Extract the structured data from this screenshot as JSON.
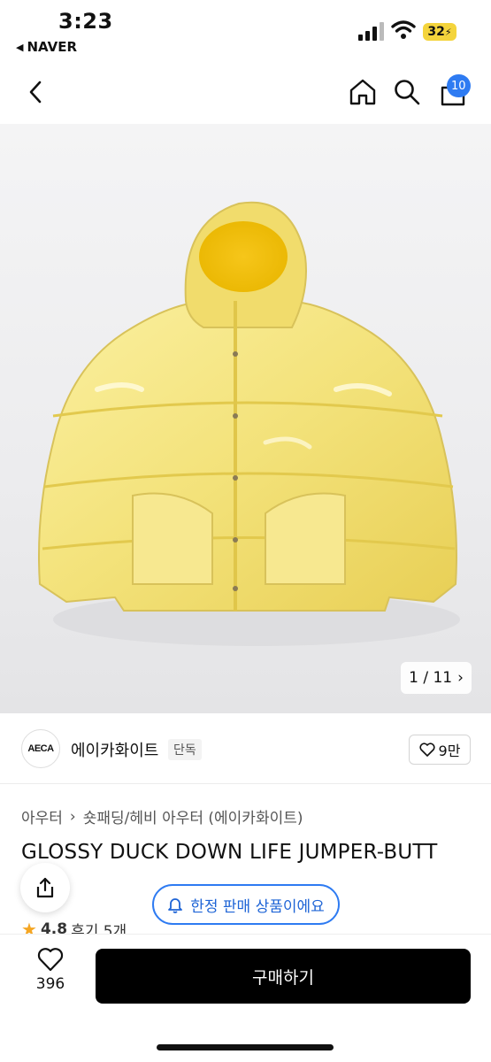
{
  "status_bar": {
    "time": "3:23",
    "back_app": "NAVER",
    "battery": "32"
  },
  "nav": {
    "cart_count": "10",
    "icons": [
      "back-chevron-icon",
      "home-icon",
      "search-icon",
      "cart-icon"
    ]
  },
  "gallery": {
    "current": "1",
    "total": "11",
    "counter": "1 / 11"
  },
  "brand": {
    "logo_text": "AECA",
    "name": "에이카화이트",
    "tag": "단독",
    "likes": "9만"
  },
  "product": {
    "breadcrumb": [
      "아우터",
      "숏패딩/헤비 아우터 (에이카화이트)"
    ],
    "title": "GLOSSY DUCK DOWN LIFE JUMPER-BUTT",
    "rating": "4.8",
    "reviews": "후기 5개"
  },
  "limited_badge": "한정 판매 상품이에요",
  "bottom_bar": {
    "wish_count": "396",
    "buy_label": "구매하기"
  },
  "colors": {
    "accent_blue": "#2e7bf2",
    "jacket_yellow": "#f3e27a",
    "buy_button": "#000000",
    "star": "#f5a623"
  }
}
